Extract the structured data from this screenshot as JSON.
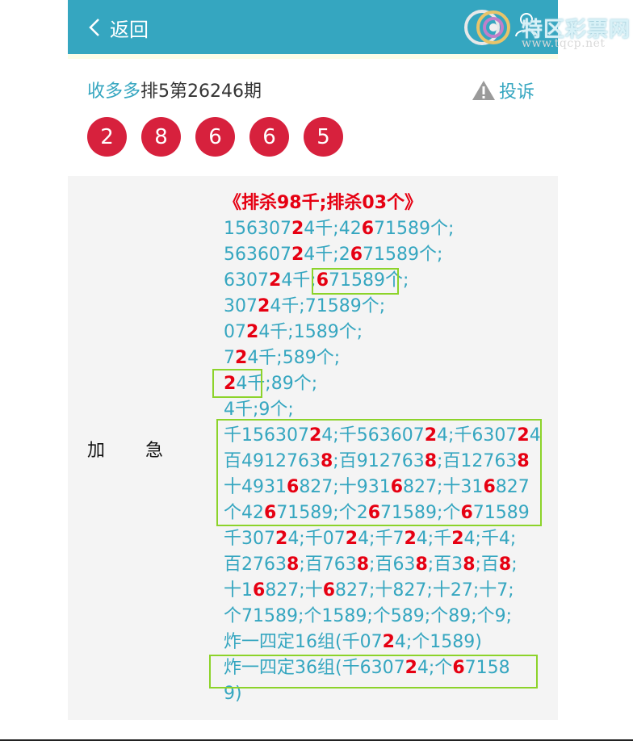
{
  "header": {
    "back_label": "返回",
    "logo_text": "特区彩票网",
    "logo_url": "www.tqcp.net",
    "bg_color": "#35a6c0"
  },
  "title": {
    "source": "收多多",
    "issue": "排5第26246期",
    "complain_label": "投诉"
  },
  "balls": [
    "2",
    "8",
    "6",
    "6",
    "5"
  ],
  "side_label": [
    "加",
    "急"
  ],
  "lines": [
    [
      [
        "《排杀98千;排杀03个》",
        "t"
      ]
    ],
    [
      [
        "156307",
        ""
      ],
      [
        "2",
        "r"
      ],
      [
        "4千;42",
        ""
      ],
      [
        "6",
        "r"
      ],
      [
        "71589个;",
        ""
      ]
    ],
    [
      [
        "563607",
        ""
      ],
      [
        "2",
        "r"
      ],
      [
        "4千;2",
        ""
      ],
      [
        "6",
        "r"
      ],
      [
        "71589个;",
        ""
      ]
    ],
    [
      [
        "6307",
        ""
      ],
      [
        "2",
        "r"
      ],
      [
        "4千;",
        ""
      ],
      [
        "6",
        "r"
      ],
      [
        "71589个;",
        ""
      ]
    ],
    [
      [
        "307",
        ""
      ],
      [
        "2",
        "r"
      ],
      [
        "4千;71589个;",
        ""
      ]
    ],
    [
      [
        "07",
        ""
      ],
      [
        "2",
        "r"
      ],
      [
        "4千;1589个;",
        ""
      ]
    ],
    [
      [
        "7",
        ""
      ],
      [
        "2",
        "r"
      ],
      [
        "4千;589个;",
        ""
      ]
    ],
    [
      [
        "2",
        "r"
      ],
      [
        "4千;89个;",
        ""
      ]
    ],
    [
      [
        "4千;9个;",
        ""
      ]
    ],
    [
      [
        "千156307",
        ""
      ],
      [
        "2",
        "r"
      ],
      [
        "4;千563607",
        ""
      ],
      [
        "2",
        "r"
      ],
      [
        "4;千6307",
        ""
      ],
      [
        "2",
        "r"
      ],
      [
        "4",
        ""
      ]
    ],
    [
      [
        "百4912763",
        ""
      ],
      [
        "8",
        "r"
      ],
      [
        ";百912763",
        ""
      ],
      [
        "8",
        "r"
      ],
      [
        ";百12763",
        ""
      ],
      [
        "8",
        "r"
      ]
    ],
    [
      [
        "十4931",
        ""
      ],
      [
        "6",
        "r"
      ],
      [
        "827;十931",
        ""
      ],
      [
        "6",
        "r"
      ],
      [
        "827;十31",
        ""
      ],
      [
        "6",
        "r"
      ],
      [
        "827",
        ""
      ]
    ],
    [
      [
        "个42",
        ""
      ],
      [
        "6",
        "r"
      ],
      [
        "71589;个2",
        ""
      ],
      [
        "6",
        "r"
      ],
      [
        "71589;个",
        ""
      ],
      [
        "6",
        "r"
      ],
      [
        "71589",
        ""
      ]
    ],
    [
      [
        "千307",
        ""
      ],
      [
        "2",
        "r"
      ],
      [
        "4;千07",
        ""
      ],
      [
        "2",
        "r"
      ],
      [
        "4;千7",
        ""
      ],
      [
        "2",
        "r"
      ],
      [
        "4;千",
        ""
      ],
      [
        "2",
        "r"
      ],
      [
        "4;千4;",
        ""
      ]
    ],
    [
      [
        "百2763",
        ""
      ],
      [
        "8",
        "r"
      ],
      [
        ";百763",
        ""
      ],
      [
        "8",
        "r"
      ],
      [
        ";百63",
        ""
      ],
      [
        "8",
        "r"
      ],
      [
        ";百3",
        ""
      ],
      [
        "8",
        "r"
      ],
      [
        ";百",
        ""
      ],
      [
        "8",
        "r"
      ],
      [
        ";",
        ""
      ]
    ],
    [
      [
        "十1",
        ""
      ],
      [
        "6",
        "r"
      ],
      [
        "827;十",
        ""
      ],
      [
        "6",
        "r"
      ],
      [
        "827;十827;十27;十7;",
        ""
      ]
    ],
    [
      [
        "个71589;个1589;个589;个89;个9;",
        ""
      ]
    ],
    [
      [
        "炸一四定16组(千07",
        ""
      ],
      [
        "2",
        "r"
      ],
      [
        "4;个1589)",
        ""
      ]
    ],
    [
      [
        "炸一四定36组(千6307",
        ""
      ],
      [
        "2",
        "r"
      ],
      [
        "4;个",
        ""
      ],
      [
        "6",
        "r"
      ],
      [
        "7158",
        ""
      ]
    ],
    [
      [
        "9)",
        ""
      ]
    ]
  ],
  "colors": {
    "accent": "#35a6c0",
    "ball": "#d7213d",
    "highlight_red": "#e60012",
    "box_green": "#8cd32a"
  }
}
